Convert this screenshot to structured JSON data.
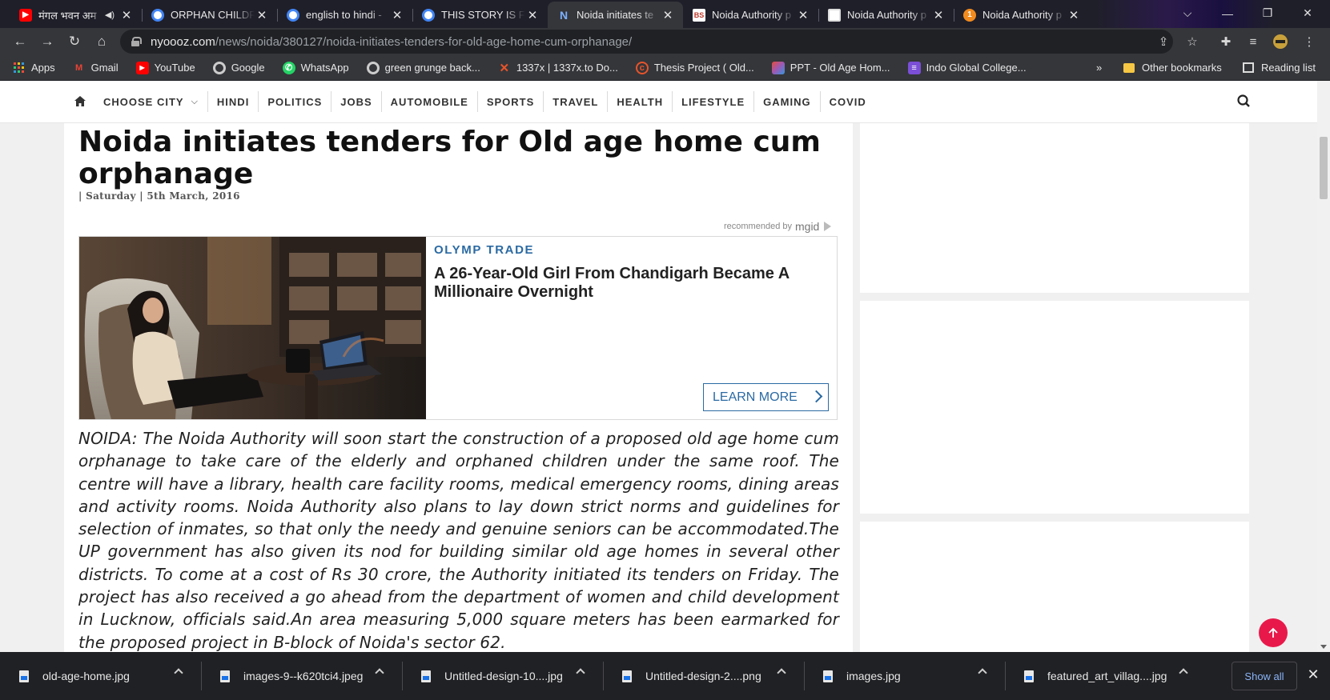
{
  "browser": {
    "tabs": [
      {
        "title": "मंगल भवन अम",
        "favicon": "youtube-icon",
        "audio": true,
        "active": false
      },
      {
        "title": "ORPHAN CHILDR",
        "favicon": "google-icon",
        "active": false
      },
      {
        "title": "english to hindi -",
        "favicon": "google-icon",
        "active": false
      },
      {
        "title": "THIS STORY IS FR",
        "favicon": "google-icon",
        "active": false
      },
      {
        "title": "Noida initiates te",
        "favicon": "nyoooz-icon",
        "active": true
      },
      {
        "title": "Noida Authority p",
        "favicon": "business-standard-icon",
        "favicon_text": "BS",
        "active": false
      },
      {
        "title": "Noida Authority p",
        "favicon": "document-icon",
        "active": false
      },
      {
        "title": "Noida Authority p",
        "favicon": "notification-icon",
        "favicon_text": "1",
        "active": false
      }
    ],
    "url": {
      "host": "nyoooz.com",
      "path": "/news/noida/380127/noida-initiates-tenders-for-old-age-home-cum-orphanage/"
    },
    "bookmarks": [
      {
        "label": "Apps",
        "icon": "apps-grid-icon"
      },
      {
        "label": "Gmail",
        "icon": "gmail-icon"
      },
      {
        "label": "YouTube",
        "icon": "youtube-icon"
      },
      {
        "label": "Google",
        "icon": "google-icon"
      },
      {
        "label": "WhatsApp",
        "icon": "whatsapp-icon"
      },
      {
        "label": "green grunge back...",
        "icon": "google-icon"
      },
      {
        "label": "1337x | 1337x.to Do...",
        "icon": "x-site-icon"
      },
      {
        "label": "Thesis Project ( Old...",
        "icon": "thesis-icon"
      },
      {
        "label": "PPT - Old Age Hom...",
        "icon": "ppt-icon"
      },
      {
        "label": "Indo Global College...",
        "icon": "college-icon"
      }
    ],
    "bookmarks_overflow": "»",
    "other_bookmarks": "Other bookmarks",
    "reading_list": "Reading list"
  },
  "site_nav": {
    "items": [
      "CHOOSE CITY",
      "HINDI",
      "POLITICS",
      "JOBS",
      "AUTOMOBILE",
      "SPORTS",
      "TRAVEL",
      "HEALTH",
      "LIFESTYLE",
      "GAMING",
      "COVID"
    ]
  },
  "article": {
    "title": "Noida initiates tenders for Old age home cum orphanage",
    "dateline": "| Saturday | 5th March, 2016",
    "body": "NOIDA: The Noida Authority will soon start the construction of a proposed old age home cum orphanage to take care of the elderly and orphaned children under the same roof. The centre will have a library, health care facility rooms, medical emergency rooms, dining areas and activity rooms. Noida Authority also plans to lay down strict norms and guidelines for selection of inmates, so that only the needy and genuine seniors can be accommodated.The UP government has also given its nod for building similar old age homes in several other districts. To come at a cost of Rs 30 crore, the Authority initiated its tenders on Friday. The project has also received a go ahead from the department of women and child development in Lucknow, officials said.An area measuring 5,000 square meters has been earmarked for the proposed project in B-block of Noida's sector 62."
  },
  "ad": {
    "recommended_by": "recommended by",
    "network": "mgid",
    "brand": "OLYMP TRADE",
    "headline": "A 26-Year-Old Girl From Chandigarh Became A Millionaire Overnight",
    "cta": "LEARN MORE"
  },
  "downloads": {
    "items": [
      "old-age-home.jpg",
      "images-9--k620tci4.jpeg",
      "Untitled-design-10....jpg",
      "Untitled-design-2....png",
      "images.jpg",
      "featured_art_villag....jpg"
    ],
    "show_all": "Show all"
  },
  "colors": {
    "accent_link": "#2b6aa3",
    "scroll_top": "#e8194a",
    "chrome_dark": "#35363a"
  }
}
